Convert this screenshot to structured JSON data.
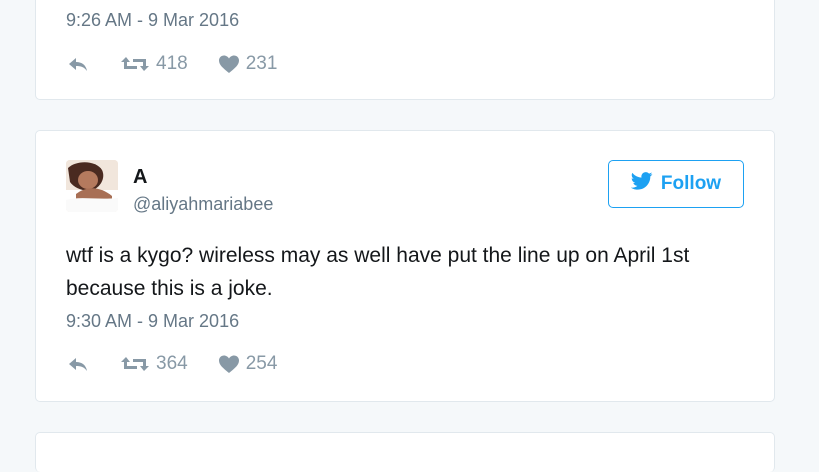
{
  "tweet_top": {
    "timestamp": "9:26 AM - 9 Mar 2016",
    "retweets": "418",
    "likes": "231"
  },
  "tweet_main": {
    "display_name": "A",
    "handle": "@aliyahmariabee",
    "follow_label": "Follow",
    "text": "wtf is a kygo? wireless may as well have put the line up on April 1st because this is a joke.",
    "timestamp": "9:30 AM - 9 Mar 2016",
    "retweets": "364",
    "likes": "254"
  },
  "colors": {
    "accent": "#1da1f2",
    "muted_text": "#657786",
    "icon_gray": "#8899a6",
    "border": "#e1e8ed"
  }
}
